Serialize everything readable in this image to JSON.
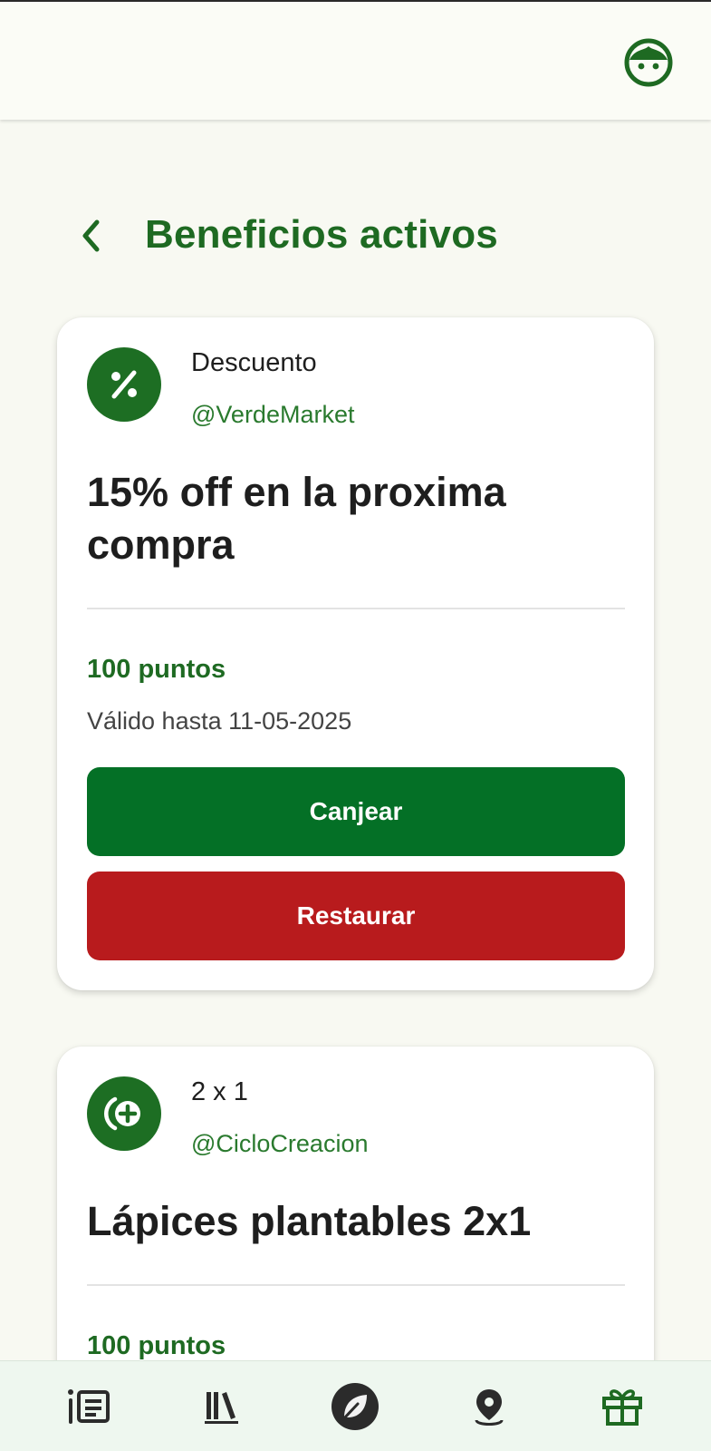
{
  "header": {
    "title": "Beneficios activos",
    "profile_icon": "face-icon",
    "back_icon": "chevron-left-icon"
  },
  "benefits": [
    {
      "type": "Descuento",
      "handle": "@VerdeMarket",
      "title": "15% off en la proxima compra",
      "points": "100 puntos",
      "valid_until": "Válido hasta 11-05-2025",
      "redeem_label": "Canjear",
      "restore_label": "Restaurar",
      "icon": "percent-icon"
    },
    {
      "type": "2 x 1",
      "handle": "@CicloCreacion",
      "title": "Lápices plantables 2x1",
      "points": "100 puntos",
      "icon": "add-circle-icon"
    }
  ],
  "nav": {
    "items": [
      {
        "icon": "list-icon"
      },
      {
        "icon": "library-icon"
      },
      {
        "icon": "leaf-icon"
      },
      {
        "icon": "location-pin-icon"
      },
      {
        "icon": "gift-icon"
      }
    ]
  },
  "colors": {
    "primary": "#1e6a22",
    "button_green": "#047026",
    "button_red": "#b81b1d",
    "background": "#f8f9f2"
  }
}
